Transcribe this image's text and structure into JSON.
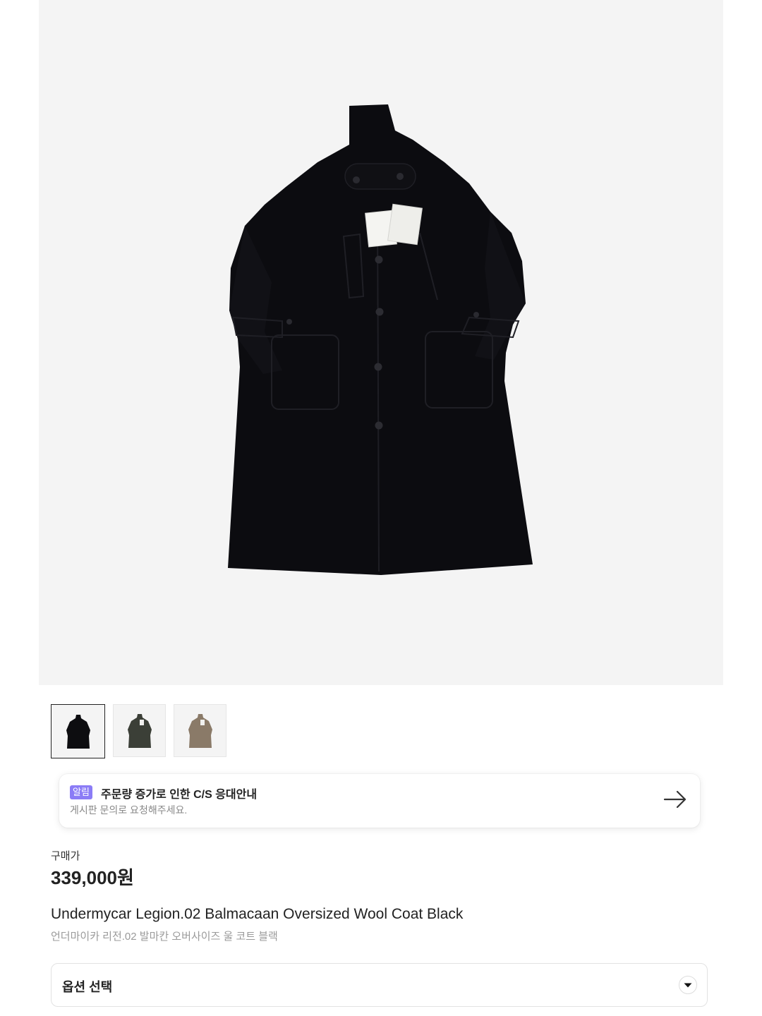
{
  "product_image": {
    "alt_icon": "coat-photo"
  },
  "thumbnails": [
    {
      "name": "thumb-black",
      "color": "#0d0d10",
      "selected": true
    },
    {
      "name": "thumb-olive",
      "color": "#3b3f37",
      "selected": false
    },
    {
      "name": "thumb-beige",
      "color": "#8a7a68",
      "selected": false
    }
  ],
  "notice": {
    "badge": "알림",
    "title": "주문량 증가로 인한 C/S 응대안내",
    "subtitle": "게시판 문의로 요청해주세요.",
    "icon": "arrow-right-icon"
  },
  "price": {
    "label": "구매가",
    "value": "339,000원"
  },
  "product": {
    "name_en": "Undermycar Legion.02 Balmacaan Oversized Wool Coat Black",
    "name_ko": "언더마이카 리전.02 발마칸 오버사이즈 울 코트 블랙"
  },
  "option": {
    "label": "옵션 선택",
    "icon": "chevron-down-icon"
  },
  "colors": {
    "accent_badge": "#8b7cf6",
    "hero_bg": "#f4f4f4"
  }
}
